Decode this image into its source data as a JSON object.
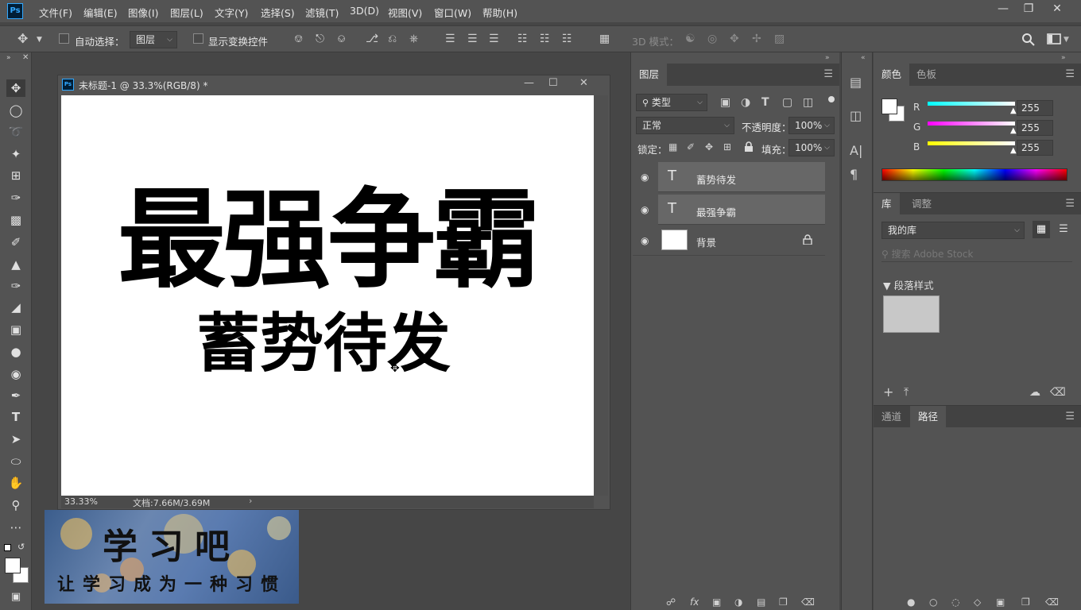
{
  "menubar": {
    "logo": "Ps",
    "items": [
      "文件(F)",
      "编辑(E)",
      "图像(I)",
      "图层(L)",
      "文字(Y)",
      "选择(S)",
      "滤镜(T)",
      "3D(D)",
      "视图(V)",
      "窗口(W)",
      "帮助(H)"
    ]
  },
  "options": {
    "auto_select_label": "自动选择：",
    "auto_select_target": "图层",
    "show_transform_label": "显示变换控件",
    "mode_3d_label": "3D 模式："
  },
  "document": {
    "title": "未标题-1 @ 33.3%(RGB/8) *",
    "zoom": "33.33%",
    "doc_size": "文档:7.66M/3.69M",
    "main_text": "最强争霸",
    "sub_text": "蓄势待发"
  },
  "watermark": {
    "title": "学习吧",
    "slogan": "让学习成为一种习惯"
  },
  "layers_panel": {
    "tab": "图层",
    "filter_label": "类型",
    "blend_mode": "正常",
    "opacity_label": "不透明度：",
    "opacity_value": "100%",
    "lock_label": "锁定：",
    "fill_label": "填充：",
    "fill_value": "100%",
    "layers": [
      {
        "name": "蓄势待发",
        "type": "text"
      },
      {
        "name": "最强争霸",
        "type": "text"
      },
      {
        "name": "背景",
        "type": "background"
      }
    ]
  },
  "color_panel": {
    "tabs": [
      "颜色",
      "色板"
    ],
    "channels": [
      {
        "label": "R",
        "value": "255"
      },
      {
        "label": "G",
        "value": "255"
      },
      {
        "label": "B",
        "value": "255"
      }
    ]
  },
  "library_panel": {
    "tabs": [
      "库",
      "调整"
    ],
    "library_select": "我的库",
    "search_placeholder": "搜索 Adobe Stock",
    "section_label": "段落样式"
  },
  "paths_panel": {
    "tabs": [
      "通道",
      "路径"
    ]
  },
  "colors": {
    "panel_bg": "#535353",
    "workspace_bg": "#464646",
    "accent_blue": "#31a8ff"
  }
}
